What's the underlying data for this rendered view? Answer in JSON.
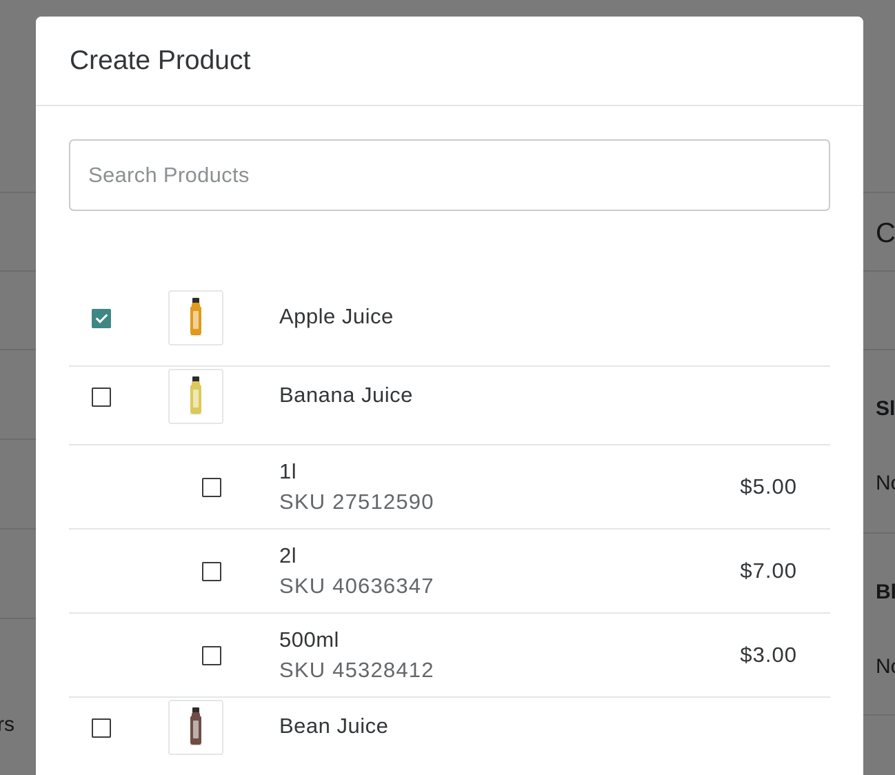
{
  "background": {
    "right_heading_partial": "C",
    "right_label_1_partial": "Sl",
    "right_value_1_partial": "No",
    "right_label_2_partial": "Bl",
    "right_value_2_partial": "No",
    "left_text_partial": "rs"
  },
  "modal": {
    "title": "Create Product",
    "search": {
      "placeholder": "Search Products",
      "value": ""
    },
    "products": [
      {
        "name": "Apple Juice",
        "checked": true,
        "image_icon": "juice-bottle-icon",
        "bottle_color": "#e19a1c",
        "variants": []
      },
      {
        "name": "Banana Juice",
        "checked": false,
        "image_icon": "juice-bottle-icon",
        "bottle_color": "#dcc95a",
        "variants": [
          {
            "name": "1l",
            "sku": "SKU 27512590",
            "price": "$5.00",
            "checked": false
          },
          {
            "name": "2l",
            "sku": "SKU 40636347",
            "price": "$7.00",
            "checked": false
          },
          {
            "name": "500ml",
            "sku": "SKU 45328412",
            "price": "$3.00",
            "checked": false
          }
        ]
      },
      {
        "name": "Bean Juice",
        "checked": false,
        "image_icon": "juice-bottle-icon",
        "bottle_color": "#6e4e45",
        "variants": []
      }
    ]
  },
  "colors": {
    "accent_checkbox": "#3e8784",
    "overlay": "rgba(0,0,0,0.5)"
  }
}
